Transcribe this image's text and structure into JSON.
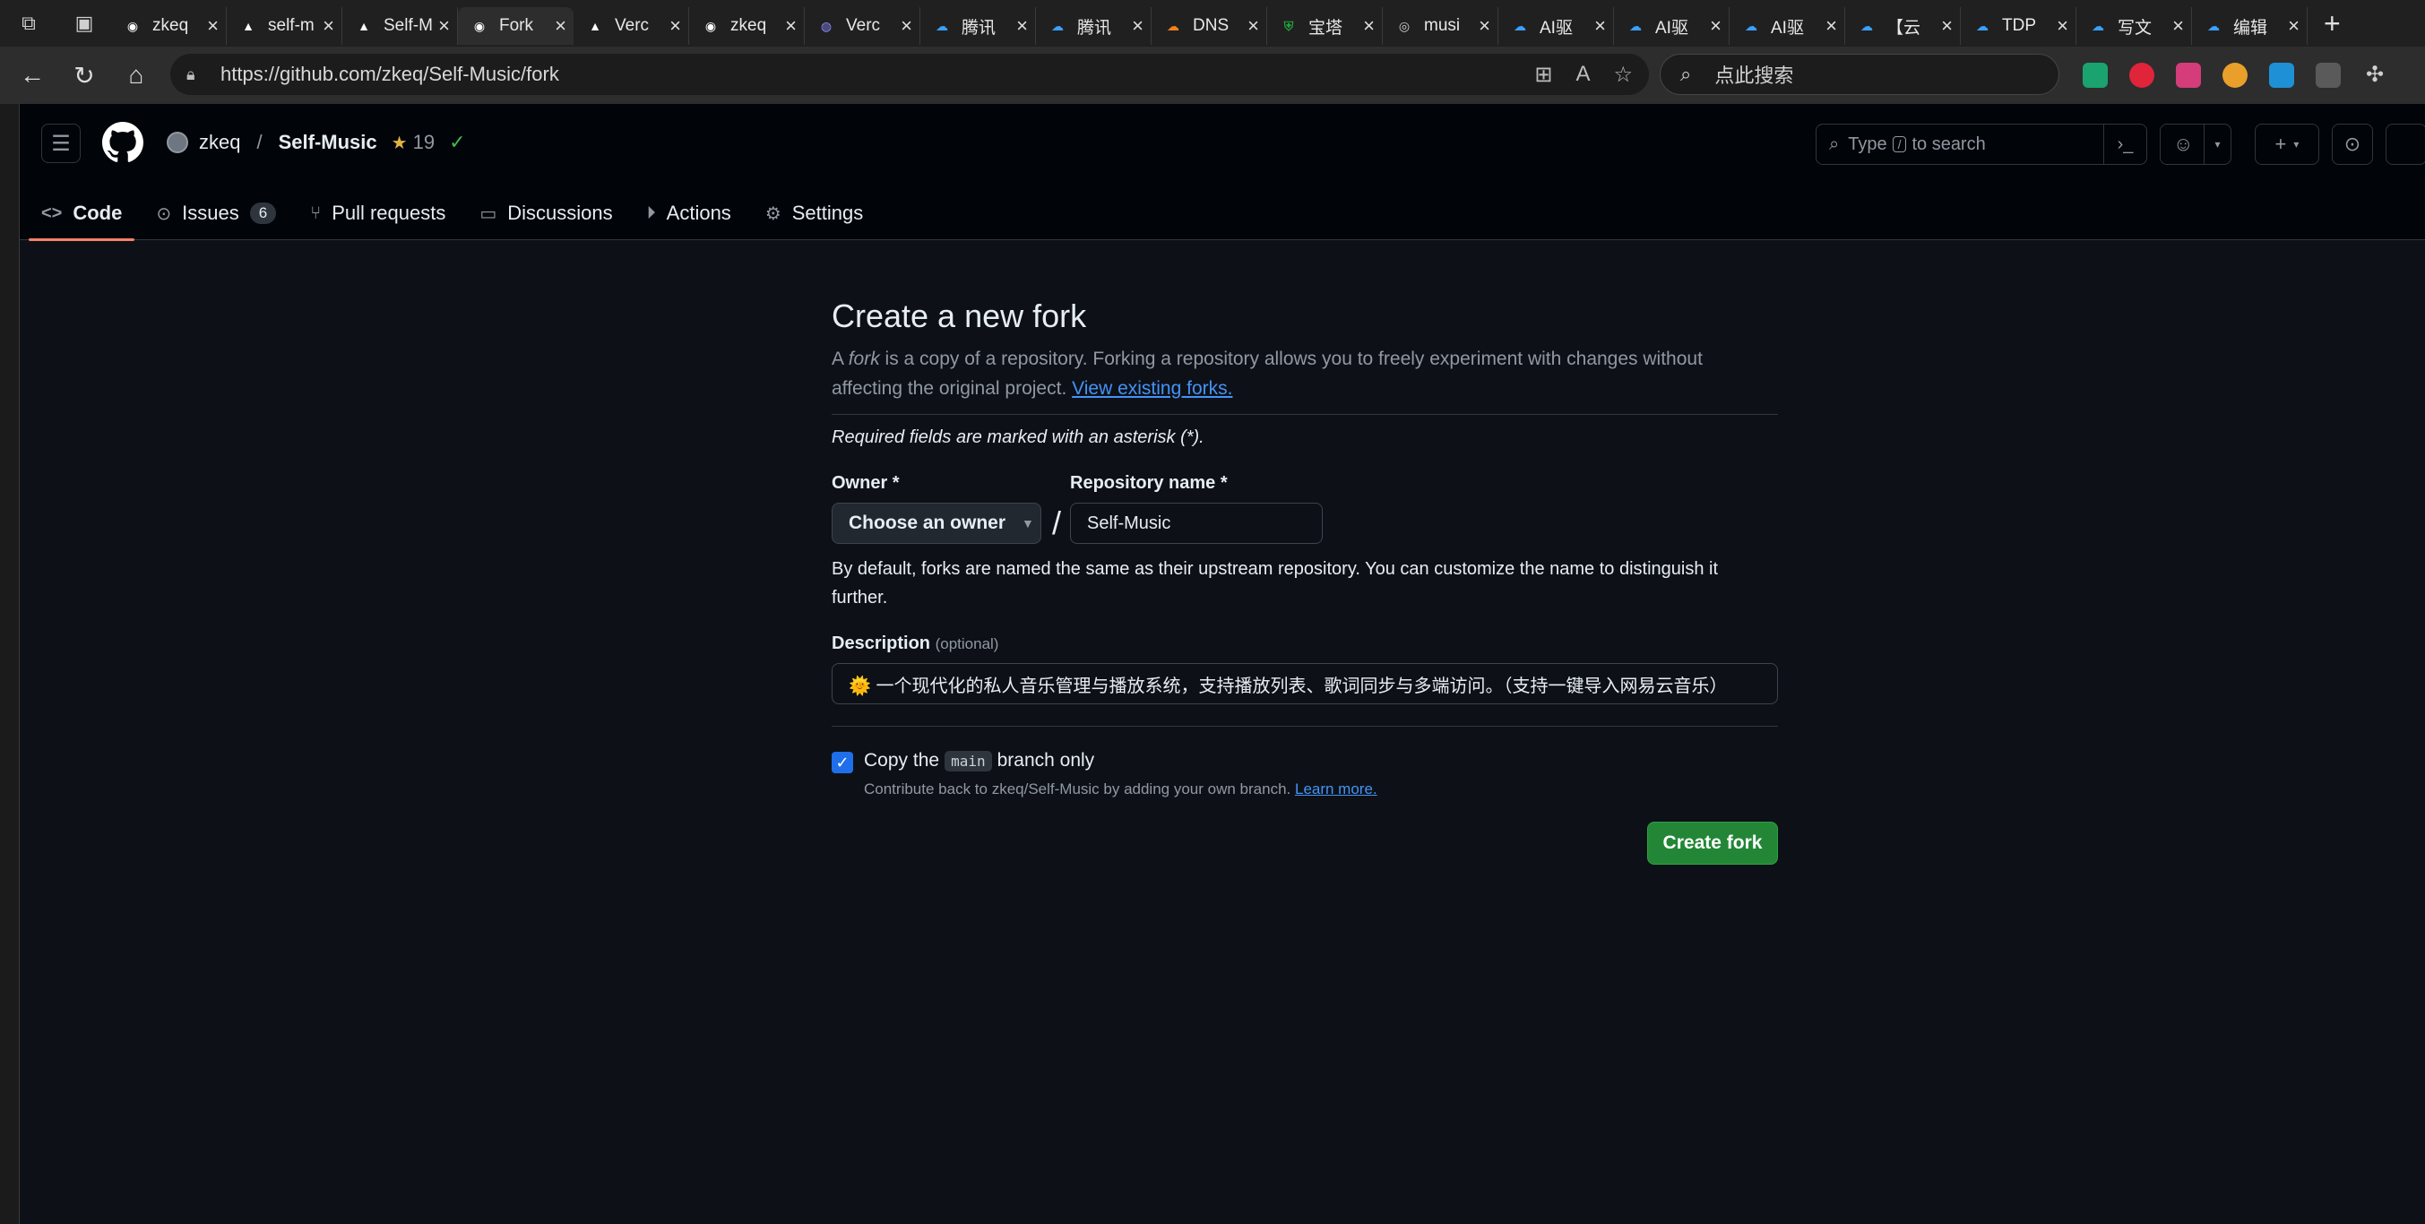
{
  "browser": {
    "tabs": [
      {
        "title": "zkeq",
        "favicon": "github-icon",
        "color": "#ffffff",
        "active": false
      },
      {
        "title": "self-m",
        "favicon": "vercel-icon",
        "color": "#ffffff",
        "active": false
      },
      {
        "title": "Self-M",
        "favicon": "vercel-icon",
        "color": "#ffffff",
        "active": false
      },
      {
        "title": "Fork",
        "favicon": "github-icon",
        "color": "#ffffff",
        "active": true
      },
      {
        "title": "Verc",
        "favicon": "vercel-icon",
        "color": "#ffffff",
        "active": false
      },
      {
        "title": "zkeq",
        "favicon": "github-icon",
        "color": "#ffffff",
        "active": false
      },
      {
        "title": "Verc",
        "favicon": "copilot-icon",
        "color": "#8b8bff",
        "active": false
      },
      {
        "title": "腾讯",
        "favicon": "cloud-icon",
        "color": "#3aa0ff",
        "active": false
      },
      {
        "title": "腾讯",
        "favicon": "cloud-icon",
        "color": "#3aa0ff",
        "active": false
      },
      {
        "title": "DNS",
        "favicon": "cloudflare-icon",
        "color": "#f38020",
        "active": false
      },
      {
        "title": "宝塔",
        "favicon": "shield-icon",
        "color": "#20a53a",
        "active": false
      },
      {
        "title": "musi",
        "favicon": "globe-icon",
        "color": "#d0d0d0",
        "active": false
      },
      {
        "title": "AI驱",
        "favicon": "cloud-icon",
        "color": "#3aa0ff",
        "active": false
      },
      {
        "title": "AI驱",
        "favicon": "cloud-icon",
        "color": "#3aa0ff",
        "active": false
      },
      {
        "title": "AI驱",
        "favicon": "cloud-icon",
        "color": "#3aa0ff",
        "active": false
      },
      {
        "title": "【云",
        "favicon": "cloud-icon",
        "color": "#3aa0ff",
        "active": false
      },
      {
        "title": "TDP",
        "favicon": "cloud-icon",
        "color": "#3aa0ff",
        "active": false
      },
      {
        "title": "写文",
        "favicon": "cloud-icon",
        "color": "#3aa0ff",
        "active": false
      },
      {
        "title": "编辑",
        "favicon": "cloud-icon",
        "color": "#3aa0ff",
        "active": false
      }
    ],
    "url": "https://github.com/zkeq/Self-Music/fork",
    "search_placeholder": "点此搜索"
  },
  "github": {
    "owner": "zkeq",
    "repo": "Self-Music",
    "stars": "19",
    "search_prefix": "Type",
    "search_key": "/",
    "search_suffix": "to search",
    "nav": {
      "code": "Code",
      "issues": "Issues",
      "issues_count": "6",
      "pulls": "Pull requests",
      "discussions": "Discussions",
      "actions": "Actions",
      "settings": "Settings"
    }
  },
  "form": {
    "title": "Create a new fork",
    "lead_a": "A ",
    "lead_fork": "fork",
    "lead_b": " is a copy of a repository. Forking a repository allows you to freely experiment with changes without affecting the original project. ",
    "lead_link": "View existing forks.",
    "required_note": "Required fields are marked with an asterisk (*).",
    "owner_label": "Owner *",
    "owner_button": "Choose an owner",
    "slash": "/",
    "repo_label": "Repository name *",
    "repo_value": "Self-Music",
    "naming_note": "By default, forks are named the same as their upstream repository. You can customize the name to distinguish it further.",
    "desc_label": "Description",
    "desc_optional": "(optional)",
    "desc_value": "🌞 一个现代化的私人音乐管理与播放系统，支持播放列表、歌词同步与多端访问。（支持一键导入网易云音乐）",
    "copy_a": "Copy the",
    "copy_branch": "main",
    "copy_b": "branch only",
    "contribute_text": "Contribute back to zkeq/Self-Music by adding your own branch.",
    "learn_more": "Learn more.",
    "create_button": "Create fork"
  }
}
